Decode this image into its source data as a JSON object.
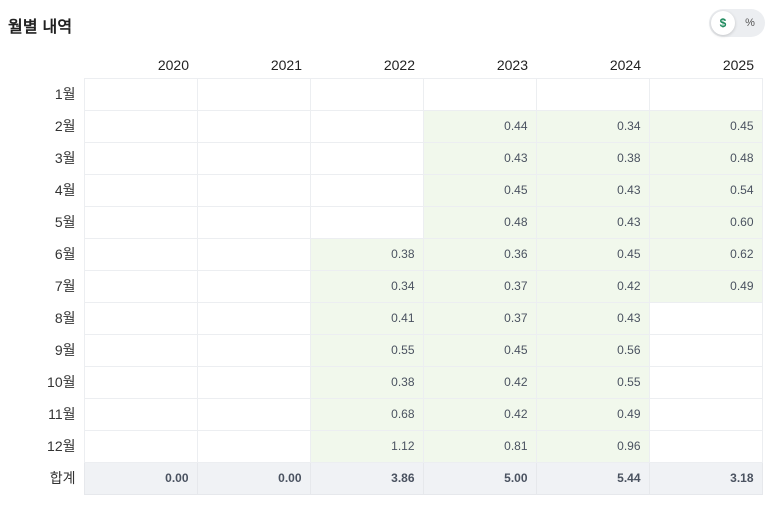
{
  "header": {
    "title": "월별 내역",
    "toggle": {
      "dollar_label": "$",
      "percent_label": "%",
      "selected": "$"
    }
  },
  "colors": {
    "filled_cell": "#f1f8ec",
    "total_row": "#f0f2f5",
    "accent": "#1f8a5e"
  },
  "table": {
    "years": [
      "2020",
      "2021",
      "2022",
      "2023",
      "2024",
      "2025"
    ],
    "rows": [
      {
        "label": "1월",
        "values": [
          "",
          "",
          "",
          "",
          "",
          ""
        ]
      },
      {
        "label": "2월",
        "values": [
          "",
          "",
          "",
          "0.44",
          "0.34",
          "0.45"
        ]
      },
      {
        "label": "3월",
        "values": [
          "",
          "",
          "",
          "0.43",
          "0.38",
          "0.48"
        ]
      },
      {
        "label": "4월",
        "values": [
          "",
          "",
          "",
          "0.45",
          "0.43",
          "0.54"
        ]
      },
      {
        "label": "5월",
        "values": [
          "",
          "",
          "",
          "0.48",
          "0.43",
          "0.60"
        ]
      },
      {
        "label": "6월",
        "values": [
          "",
          "",
          "0.38",
          "0.36",
          "0.45",
          "0.62"
        ]
      },
      {
        "label": "7월",
        "values": [
          "",
          "",
          "0.34",
          "0.37",
          "0.42",
          "0.49"
        ]
      },
      {
        "label": "8월",
        "values": [
          "",
          "",
          "0.41",
          "0.37",
          "0.43",
          ""
        ]
      },
      {
        "label": "9월",
        "values": [
          "",
          "",
          "0.55",
          "0.45",
          "0.56",
          ""
        ]
      },
      {
        "label": "10월",
        "values": [
          "",
          "",
          "0.38",
          "0.42",
          "0.55",
          ""
        ]
      },
      {
        "label": "11월",
        "values": [
          "",
          "",
          "0.68",
          "0.42",
          "0.49",
          ""
        ]
      },
      {
        "label": "12월",
        "values": [
          "",
          "",
          "1.12",
          "0.81",
          "0.96",
          ""
        ]
      }
    ],
    "total": {
      "label": "합계",
      "values": [
        "0.00",
        "0.00",
        "3.86",
        "5.00",
        "5.44",
        "3.18"
      ]
    }
  }
}
